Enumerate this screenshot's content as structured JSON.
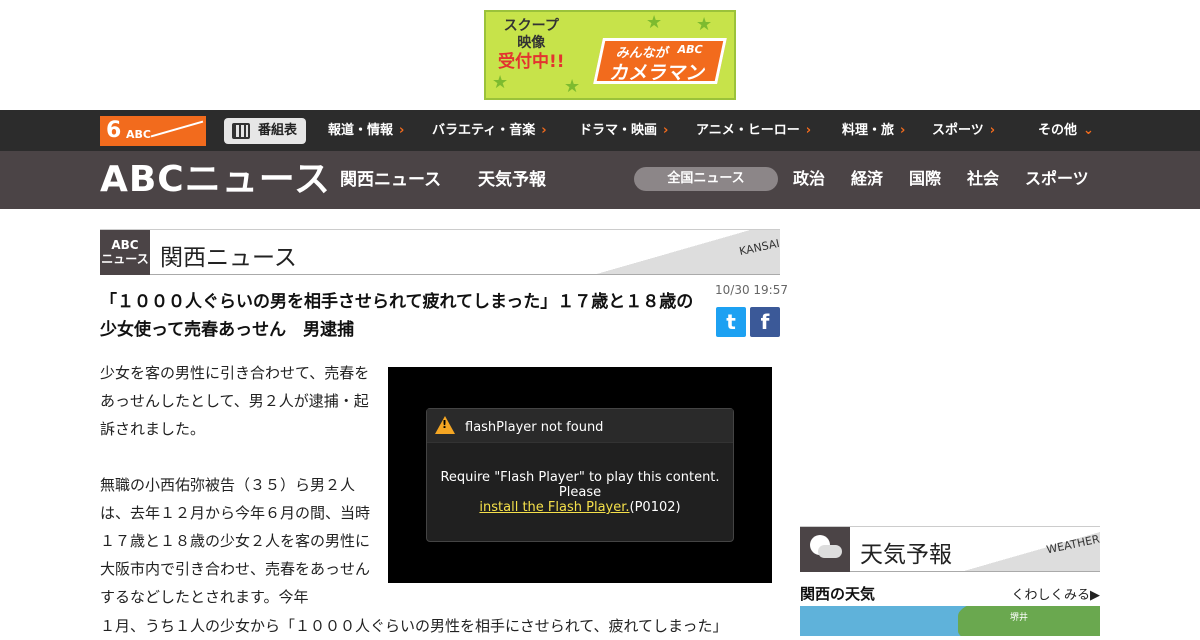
{
  "banner": {
    "line1": "スクープ",
    "line2": "映像",
    "line3": "受付中!!",
    "logo_top": "みんなが",
    "logo_abc": "ABC",
    "logo_main": "カメラマン"
  },
  "topnav": {
    "logo_num": "6",
    "logo_text": "ABC",
    "schedule": "番組表",
    "items": [
      "報道・情報",
      "バラエティ・音楽",
      "ドラマ・映画",
      "アニメ・ヒーロー",
      "料理・旅",
      "スポーツ",
      "その他"
    ],
    "chevron": "›",
    "more_chevron": "⌄"
  },
  "subnav": {
    "brand": "ABCニュース",
    "links": [
      "関西ニュース",
      "天気予報"
    ],
    "pill": "全国ニュース",
    "cats": [
      "政治",
      "経済",
      "国際",
      "社会",
      "スポーツ"
    ]
  },
  "section": {
    "logo_l1": "ABC",
    "logo_l2": "ニュース",
    "title": "関西ニュース",
    "en": "KANSAI"
  },
  "article": {
    "date": "10/30 19:57",
    "headline": "「１０００人ぐらいの男を相手させられて疲れてしまった」１７歳と１８歳の少女使って売春あっせん　男逮捕",
    "p1": "少女を客の男性に引き合わせて、売春をあっせんしたとして、男２人が逮捕・起訴されました。",
    "p2": "無職の小西佑弥被告（３５）ら男２人は、去年１２月から今年６月の間、当時１７歳と１８歳の少女２人を客の男性に大阪市内で引き合わせ、売春をあっせんするなどしたとされます。今年",
    "p3": "１月、うち１人の少女から「１０００人ぐらいの男性を相手にさせられて、疲れてしまった」"
  },
  "share": {
    "twitter": "t",
    "facebook": "f"
  },
  "video": {
    "error_title": "flashPlayer not found",
    "msg1": "Require \"Flash Player\" to play this content.",
    "msg2": "Please",
    "link": "install the Flash Player.",
    "code": "(P0102)",
    "warn_glyph": "!"
  },
  "weather": {
    "title": "天気予報",
    "en": "WEATHER",
    "region": "関西の天気",
    "more": "くわしくみる▶",
    "city": "堺井"
  }
}
